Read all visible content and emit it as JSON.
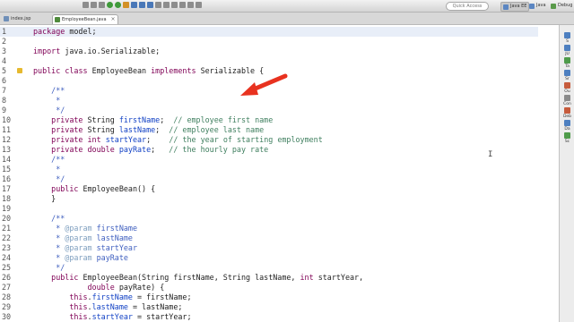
{
  "toolbar": {
    "quick_access_placeholder": "Quick Access",
    "perspectives": [
      {
        "label": "Java EE",
        "selected": true
      },
      {
        "label": "Java",
        "selected": false
      },
      {
        "label": "Debug",
        "selected": false
      }
    ]
  },
  "tabs": [
    {
      "label": "index.jsp",
      "active": false
    },
    {
      "label": "EmployeeBean.java",
      "active": true
    }
  ],
  "right_panel": {
    "items": [
      "S",
      "JU",
      "Ta",
      "Sr",
      "Ou",
      "Con",
      "Deb",
      "Da",
      "Sc"
    ]
  },
  "editor": {
    "lines": [
      {
        "num": "1",
        "text": "package model;"
      },
      {
        "num": "2",
        "text": ""
      },
      {
        "num": "3",
        "text": "import java.io.Serializable;"
      },
      {
        "num": "4",
        "text": ""
      },
      {
        "num": "5",
        "text": "public class EmployeeBean implements Serializable {"
      },
      {
        "num": "6",
        "text": ""
      },
      {
        "num": "7",
        "text": "    /**"
      },
      {
        "num": "8",
        "text": "     *"
      },
      {
        "num": "9",
        "text": "     */"
      },
      {
        "num": "10",
        "text": "    private String firstName;  // employee first name"
      },
      {
        "num": "11",
        "text": "    private String lastName;  // employee last name"
      },
      {
        "num": "12",
        "text": "    private int startYear;    // the year of starting employment"
      },
      {
        "num": "13",
        "text": "    private double payRate;   // the hourly pay rate"
      },
      {
        "num": "14",
        "text": "    /**"
      },
      {
        "num": "15",
        "text": "     *"
      },
      {
        "num": "16",
        "text": "     */"
      },
      {
        "num": "17",
        "text": "    public EmployeeBean() {"
      },
      {
        "num": "18",
        "text": "    }"
      },
      {
        "num": "19",
        "text": ""
      },
      {
        "num": "20",
        "text": "    /**"
      },
      {
        "num": "21",
        "text": "     * @param firstName"
      },
      {
        "num": "22",
        "text": "     * @param lastName"
      },
      {
        "num": "23",
        "text": "     * @param startYear"
      },
      {
        "num": "24",
        "text": "     * @param payRate"
      },
      {
        "num": "25",
        "text": "     */"
      },
      {
        "num": "26",
        "text": "    public EmployeeBean(String firstName, String lastName, int startYear,"
      },
      {
        "num": "27",
        "text": "            double payRate) {"
      },
      {
        "num": "28",
        "text": "        this.firstName = firstName;"
      },
      {
        "num": "29",
        "text": "        this.lastName = lastName;"
      },
      {
        "num": "30",
        "text": "        this.startYear = startYear;"
      }
    ]
  },
  "colors": {
    "keyword": "#7f0055",
    "field": "#0f3fc4",
    "comment": "#3f7f5f",
    "javadoc": "#3f5fbf",
    "annotation_arrow": "#e8321f"
  }
}
